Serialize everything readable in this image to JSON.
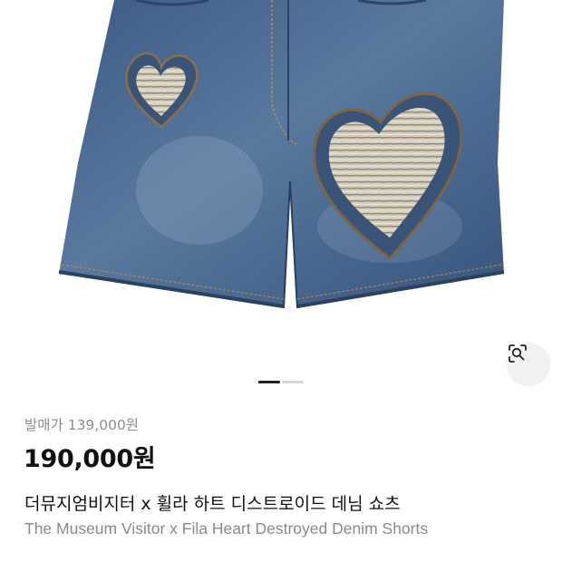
{
  "product": {
    "image_alt": "denim-shorts-photo",
    "image_count": 2,
    "current_image_index": 1,
    "release_price": "발매가 139,000원",
    "price": "190,000원",
    "title_ko": "더뮤지엄비지터 x 휠라 하트 디스트로이드 데님 쇼츠",
    "title_en": "The Museum Visitor x Fila Heart Destroyed Denim Shorts"
  },
  "icons": {
    "lens": "visual-search-icon"
  },
  "colors": {
    "denim": "#4a6a92",
    "price_text": "#111111",
    "muted_text": "#8d8d8d",
    "pager_active": "#222222",
    "pager_inactive": "#d6d6d6"
  }
}
